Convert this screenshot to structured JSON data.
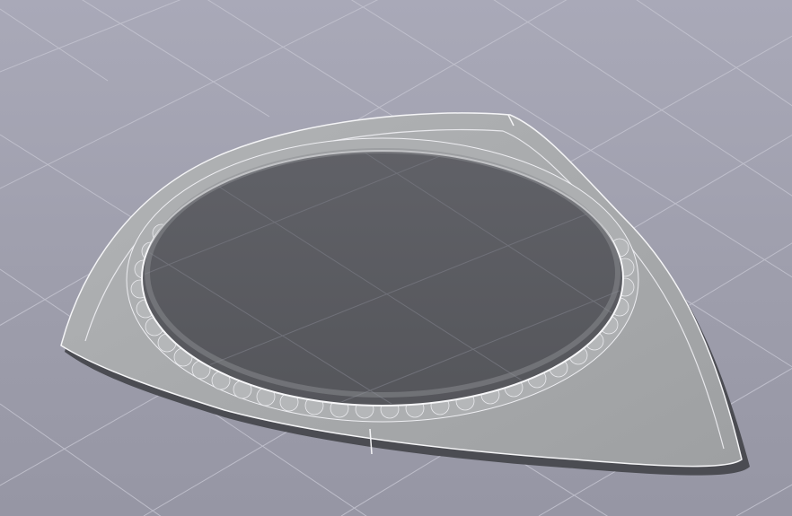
{
  "scene": {
    "description_label": "",
    "model_name": "",
    "background_color": "#9d9dab",
    "grid_color": "#c3c3cf",
    "recess_color": "#5b5c61",
    "shell_color": "#a3a5a7",
    "edge_color": "#f4f4f6",
    "rim_dark_color": "#4b4c52"
  }
}
